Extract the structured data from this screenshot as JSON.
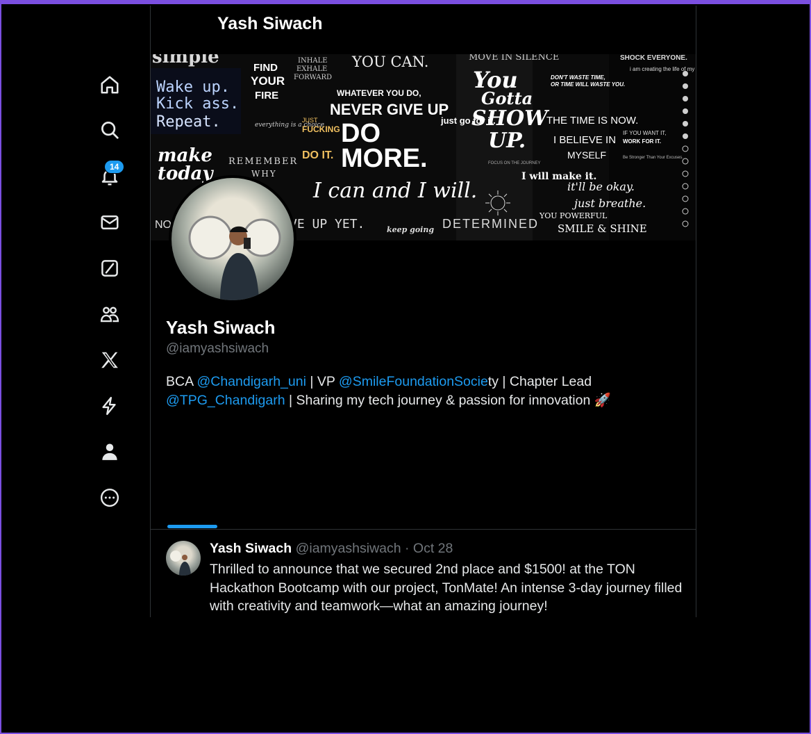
{
  "header": {
    "title": "Yash Siwach"
  },
  "nav": {
    "items": [
      {
        "name": "home",
        "icon": "home-icon"
      },
      {
        "name": "explore",
        "icon": "search-icon"
      },
      {
        "name": "notifications",
        "icon": "bell-icon",
        "badge": "14"
      },
      {
        "name": "messages",
        "icon": "mail-icon"
      },
      {
        "name": "grok",
        "icon": "grok-icon"
      },
      {
        "name": "communities",
        "icon": "people-icon"
      },
      {
        "name": "premium",
        "icon": "x-logo-icon"
      },
      {
        "name": "verified-orgs",
        "icon": "lightning-icon"
      },
      {
        "name": "profile",
        "icon": "person-icon"
      },
      {
        "name": "more",
        "icon": "more-circle-icon"
      }
    ]
  },
  "banner": {
    "texts": {
      "find": "FIND",
      "your": "YOUR",
      "fire": "FIRE",
      "inhale": "INHALE",
      "exhale": "EXHALE",
      "forward": "FORWARD",
      "you_can": "YOU CAN.",
      "whatever": "WHATEVER YOU DO,",
      "never": "NEVER GIVE UP",
      "do": "DO",
      "more": "MORE.",
      "wake": "Wake up.",
      "kick": "Kick ass.",
      "repeat": "Repeat.",
      "make": "make",
      "today": "today",
      "remember": "REMEMBER",
      "why": "WHY",
      "i_can": "I can and I will.",
      "ve_up_yet": "VE UP YET.",
      "keep_going": "keep going",
      "determined": "DETERMINED",
      "you_gotta": "You",
      "gotta": "Gotta",
      "show": "SHOW",
      "up": "UP.",
      "time_is_now": "THE TIME IS NOW.",
      "believe": "I BELIEVE IN",
      "myself": "MYSELF",
      "dont_waste": "DON'T WASTE TIME,",
      "or_time": "OR TIME WILL WASTE YOU.",
      "just_go": "just go for it.",
      "fucking": "FUCKING",
      "do_it": "DO IT.",
      "just": "JUST",
      "everything": "everything is a choice",
      "i_will": "I will make it.",
      "be_okay": "it'll be okay.",
      "breathe": "just breathe.",
      "you_powerful": "YOU POWERFUL",
      "smile": "SMILE & SHINE",
      "move": "MOVE IN SILENCE",
      "shock": "SHOCK EVERYONE.",
      "creating": "i am creating the life of my dream",
      "if_you_want": "IF YOU WANT IT,",
      "work_for_it": "WORK FOR IT.",
      "stronger": "Be Stronger Than Your Excuses.",
      "simple": "simple",
      "no": "NO",
      "focus": "FOCUS ON THE JOURNEY"
    }
  },
  "profile": {
    "name": "Yash Siwach",
    "handle": "@iamyashsiwach",
    "bio": {
      "p1": "BCA ",
      "link1": "@Chandigarh_uni",
      "p2": " | VP ",
      "link2": "@SmileFoundationSocie",
      "p3": "ty | Chapter Lead",
      "link3": "@TPG_Chandigarh",
      "p4": " | Sharing my tech journey & passion for innovation ",
      "emoji": "🚀"
    }
  },
  "post": {
    "name": "Yash Siwach",
    "meta": "@iamyashsiwach · Oct 28",
    "text": "Thrilled to announce that we secured 2nd place and $1500! at the TON Hackathon Bootcamp with our project, TonMate! An intense 3-day journey filled with creativity and teamwork—what an amazing journey!"
  },
  "colors": {
    "accent": "#1d9bf0",
    "background": "#000000",
    "frame": "#7b4fe0"
  }
}
